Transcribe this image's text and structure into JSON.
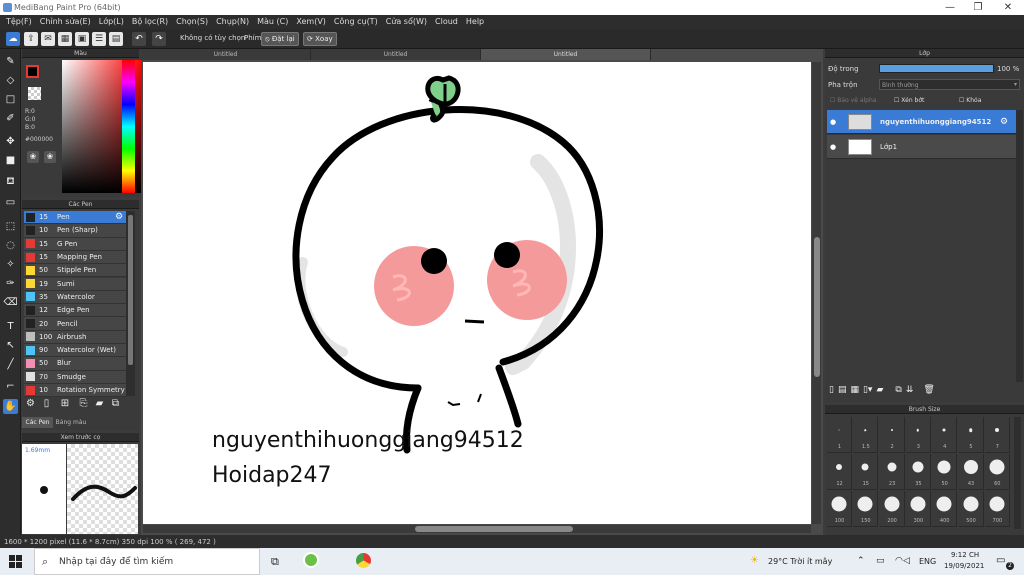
{
  "window": {
    "title": "MediBang Paint Pro (64bit)",
    "minimize": "—",
    "maximize": "❐",
    "close": "✕"
  },
  "menu": [
    "Tệp(F)",
    "Chỉnh sửa(E)",
    "Lớp(L)",
    "Bộ lọc(R)",
    "Chọn(S)",
    "Chụp(N)",
    "Màu (C)",
    "Xem(V)",
    "Công cụ(T)",
    "Cửa sổ(W)",
    "Cloud",
    "Help"
  ],
  "toolbar": {
    "no_options": "Không có tùy chọn",
    "key_label": "Phím",
    "reset": "Đặt lại",
    "rotate": "Xoay"
  },
  "color_panel": {
    "title": "Màu",
    "r": "R:0",
    "g": "G:0",
    "b": "B:0",
    "hex": "#000000"
  },
  "brush_panel": {
    "title": "Các Pen",
    "brushes": [
      {
        "size": "15",
        "name": "Pen",
        "color": "#3a7bd5"
      },
      {
        "size": "10",
        "name": "Pen (Sharp)",
        "color": "#222222"
      },
      {
        "size": "15",
        "name": "G Pen",
        "color": "#e53935"
      },
      {
        "size": "15",
        "name": "Mapping Pen",
        "color": "#e53935"
      },
      {
        "size": "50",
        "name": "Stipple Pen",
        "color": "#fdd835"
      },
      {
        "size": "19",
        "name": "Sumi",
        "color": "#fdd835"
      },
      {
        "size": "35",
        "name": "Watercolor",
        "color": "#4fc3f7"
      },
      {
        "size": "12",
        "name": "Edge Pen",
        "color": "#222222"
      },
      {
        "size": "20",
        "name": "Pencil",
        "color": "#222222"
      },
      {
        "size": "100",
        "name": "Airbrush",
        "color": "#bdbdbd"
      },
      {
        "size": "90",
        "name": "Watercolor (Wet)",
        "color": "#4fc3f7"
      },
      {
        "size": "50",
        "name": "Blur",
        "color": "#f48fb1"
      },
      {
        "size": "70",
        "name": "Smudge",
        "color": "#e0e0e0"
      },
      {
        "size": "10",
        "name": "Rotation Symmetry",
        "color": "#e53935"
      }
    ],
    "tab1": "Các Pen",
    "tab2": "Bảng màu"
  },
  "preview_panel": {
    "title": "Xem trước cọ",
    "size": "1.69mm"
  },
  "doc_tabs": [
    "Untitled",
    "Untitled",
    "Untitled"
  ],
  "canvas": {
    "text1": "nguyenthihuonggiang94512",
    "text2": "Hoidap247"
  },
  "layer_panel": {
    "title": "Lớp",
    "opacity_label": "Độ trong",
    "opacity_value": "100 %",
    "opacity_fraction": 1.0,
    "blend_label": "Pha trộn",
    "blend_value": "Bình thường",
    "protect_alpha": "Bảo vệ alpha",
    "clipping": "Xén bớt",
    "lock": "Khóa",
    "layers": [
      {
        "name": "nguyenthihuonggiang94512"
      },
      {
        "name": "Lớp1"
      }
    ]
  },
  "brushsize_panel": {
    "title": "Brush Size",
    "sizes": [
      "1",
      "1.5",
      "2",
      "3",
      "4",
      "5",
      "7",
      "12",
      "15",
      "23",
      "35",
      "50",
      "43",
      "60",
      "100",
      "150",
      "200",
      "300",
      "400",
      "500",
      "700"
    ]
  },
  "status": {
    "text": "1600 * 1200 pixel   (11.6 * 8.7cm)   350 dpi   100 %   ( 269, 472 )"
  },
  "taskbar": {
    "search": "Nhập tại đây để tìm kiếm",
    "weather": "29°C  Trời ít mây",
    "lang": "ENG",
    "time": "9:12 CH",
    "date": "19/09/2021",
    "notif": "2"
  }
}
